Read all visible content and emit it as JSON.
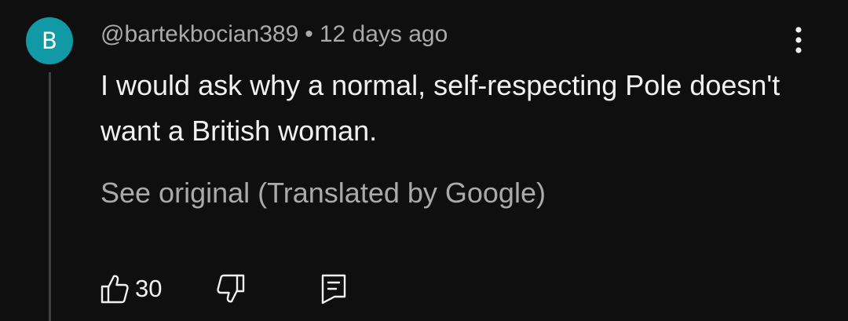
{
  "comment": {
    "avatar": {
      "letter": "B",
      "color": "#119aa6"
    },
    "author": "@bartekbocian389",
    "separator": "•",
    "time": "12 days ago",
    "text": "I would ask why a normal, self-respecting Pole doesn't want a British woman.",
    "see_original": "See original (Translated by Google)",
    "likes": "30"
  },
  "icons": {
    "more": "vertical-ellipsis-icon",
    "like": "thumbs-up-icon",
    "dislike": "thumbs-down-icon",
    "reply": "reply-comment-icon"
  },
  "colors": {
    "background": "#0f0f0f",
    "primary_text": "#f1f1f1",
    "secondary_text": "#aaaaaa"
  }
}
